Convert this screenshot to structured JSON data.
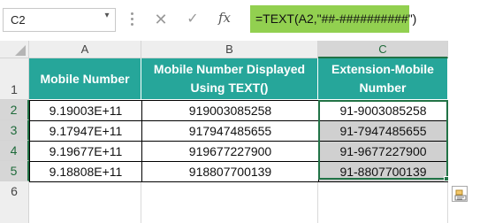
{
  "name_box": {
    "value": "C2"
  },
  "formula_bar": {
    "cancel_glyph": "✕",
    "enter_glyph": "✓",
    "fx_label": "fx",
    "formula": "=TEXT(A2,\"##-##########\")",
    "highlight_color": "#92d050"
  },
  "columns": [
    "A",
    "B",
    "C"
  ],
  "rows": [
    "1",
    "2",
    "3",
    "4",
    "5",
    "6"
  ],
  "table": {
    "headers": [
      [
        "Mobile Number",
        ""
      ],
      [
        "Mobile Number Displayed",
        "Using TEXT()"
      ],
      [
        "Extension-Mobile",
        "Number"
      ]
    ],
    "data": [
      [
        "9.19003E+11",
        "919003085258",
        "91-9003085258"
      ],
      [
        "9.17947E+11",
        "917947485655",
        "91-7947485655"
      ],
      [
        "9.19677E+11",
        "919677227900",
        "91-9677227900"
      ],
      [
        "9.18808E+11",
        "918807700139",
        "91-8807700139"
      ]
    ],
    "header_color": "#26a69a"
  },
  "icons": {
    "name_box_dropdown": "chevron-down-icon",
    "quick_analysis": "quick-analysis-icon"
  }
}
